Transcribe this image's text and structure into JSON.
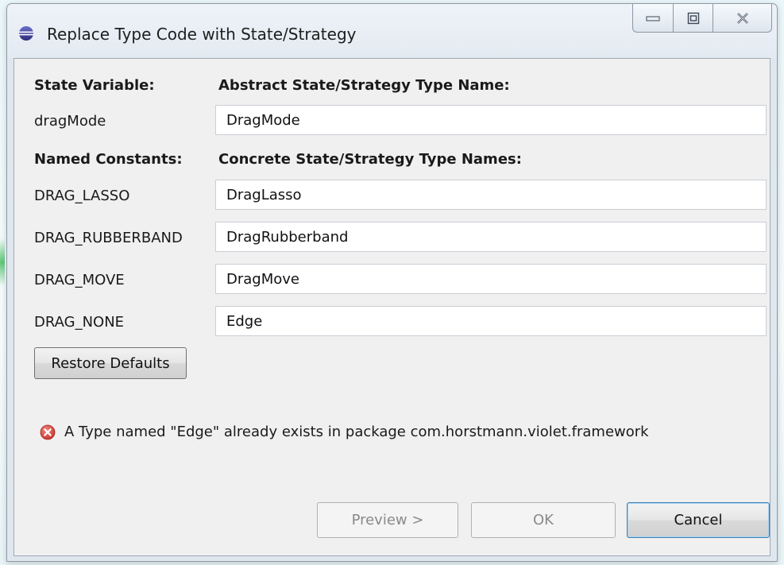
{
  "window": {
    "title": "Replace Type Code with State/Strategy"
  },
  "headers": {
    "state_variable": "State Variable:",
    "abstract_type_name": "Abstract State/Strategy Type Name:",
    "named_constants": "Named Constants:",
    "concrete_type_names": "Concrete State/Strategy Type Names:"
  },
  "state": {
    "variable": "dragMode",
    "abstract_type_value": "DragMode"
  },
  "constants": [
    {
      "name": "DRAG_LASSO",
      "value": "DragLasso"
    },
    {
      "name": "DRAG_RUBBERBAND",
      "value": "DragRubberband"
    },
    {
      "name": "DRAG_MOVE",
      "value": "DragMove"
    },
    {
      "name": "DRAG_NONE",
      "value": "Edge"
    }
  ],
  "buttons": {
    "restore_defaults": "Restore Defaults",
    "preview": "Preview >",
    "ok": "OK",
    "cancel": "Cancel"
  },
  "status": {
    "icon": "error-icon",
    "message": "A Type named \"Edge\" already exists in package com.horstmann.violet.framework"
  },
  "colors": {
    "error": "#d9453b",
    "default_button_border": "#3c7fb1"
  }
}
